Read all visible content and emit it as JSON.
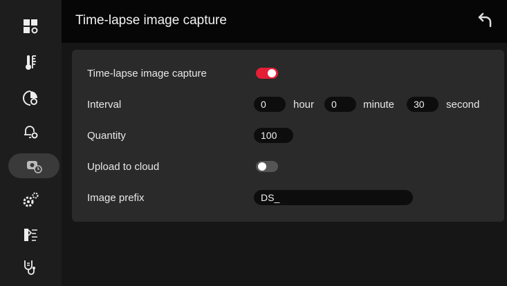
{
  "header": {
    "title": "Time-lapse image capture"
  },
  "sidebar": {
    "items": [
      {
        "icon": "grid-settings-icon"
      },
      {
        "icon": "thermometer-icon"
      },
      {
        "icon": "palette-settings-icon"
      },
      {
        "icon": "alarm-bell-settings-icon"
      },
      {
        "icon": "timelapse-camera-icon",
        "active": true
      },
      {
        "icon": "gears-icon"
      },
      {
        "icon": "laser-icon"
      },
      {
        "icon": "stethoscope-icon"
      }
    ]
  },
  "settings": {
    "timelapse": {
      "label": "Time-lapse image capture",
      "enabled": true
    },
    "interval": {
      "label": "Interval",
      "hour_value": "0",
      "hour_unit": "hour",
      "minute_value": "0",
      "minute_unit": "minute",
      "second_value": "30",
      "second_unit": "second"
    },
    "quantity": {
      "label": "Quantity",
      "value": "100"
    },
    "upload": {
      "label": "Upload to cloud",
      "enabled": false
    },
    "prefix": {
      "label": "Image prefix",
      "value": "DS_"
    }
  },
  "colors": {
    "accent": "#e51f35",
    "panel": "#2a2a2a",
    "header": "#060606"
  }
}
